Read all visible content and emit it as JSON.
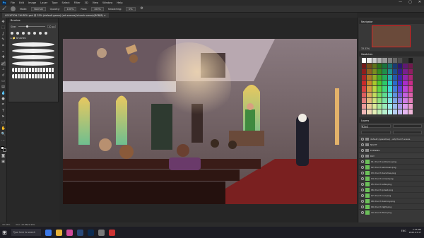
{
  "app": {
    "logo": "Ps",
    "menus": [
      "File",
      "Edit",
      "Image",
      "Layer",
      "Type",
      "Select",
      "Filter",
      "3D",
      "View",
      "Window",
      "Help"
    ],
    "window_controls": [
      "—",
      "▢",
      "✕"
    ]
  },
  "options_bar": {
    "mode_label": "Mode:",
    "mode_value": "Normal",
    "opacity_label": "Opacity:",
    "opacity_value": "100%",
    "flow_label": "Flow:",
    "flow_value": "100%",
    "smoothing_label": "Smoothing:",
    "smoothing_value": "0%"
  },
  "document_tab": {
    "title": "LOCATION CHURCH.psd @ 33% (default game) (art scenes)/church scene)(RGB/8) ×"
  },
  "toolbar": {
    "tools": [
      "move-tool",
      "marquee-tool",
      "lasso-tool",
      "quick-select-tool",
      "crop-tool",
      "eyedropper-tool",
      "healing-tool",
      "brush-tool",
      "stamp-tool",
      "history-brush-tool",
      "eraser-tool",
      "gradient-tool",
      "blur-tool",
      "dodge-tool",
      "pen-tool",
      "type-tool",
      "path-select-tool",
      "shape-tool",
      "hand-tool",
      "zoom-tool"
    ],
    "active_tool": "brush-tool",
    "colors": {
      "foreground": "#f2f2f2",
      "background": "#111111"
    }
  },
  "brushes_panel": {
    "title": "Brushes",
    "size_label": "Size:",
    "size_value": "20 px",
    "folder_label": "▸ 📁 brushes"
  },
  "navigator_panel": {
    "title": "Navigator",
    "zoom": "33.33%"
  },
  "swatches_panel": {
    "title": "Swatches"
  },
  "layers_panel": {
    "title": "Layers",
    "kind_label": "Kind",
    "layers": [
      {
        "name": "default (operative) - art/church scene",
        "type": "group"
      },
      {
        "name": "NIGHT",
        "type": "folder"
      },
      {
        "name": "EVENING",
        "type": "folder"
      },
      {
        "name": "DAY",
        "type": "group"
      },
      {
        "name": "01 church entrance.png",
        "type": "layer"
      },
      {
        "name": "02 church windows.png",
        "type": "layer"
      },
      {
        "name": "03 church benches.png",
        "type": "layer"
      },
      {
        "name": "04 church crowd.png",
        "type": "layer"
      },
      {
        "name": "05 church altar.png",
        "type": "layer"
      },
      {
        "name": "06 church priest.png",
        "type": "layer"
      },
      {
        "name": "07 church nun.png",
        "type": "layer"
      },
      {
        "name": "08 church balcony.png",
        "type": "layer"
      },
      {
        "name": "09 church light.png",
        "type": "layer"
      },
      {
        "name": "10 church floor.png",
        "type": "layer"
      }
    ]
  },
  "status_bar": {
    "zoom": "33.33%",
    "doc_info": "Doc: 22.8M/1.93G"
  },
  "taskbar": {
    "start": "⊞",
    "search_placeholder": "Type here to search",
    "tray_lang": "ENG",
    "time": "2:55 PM",
    "date": "2022-03-17"
  }
}
